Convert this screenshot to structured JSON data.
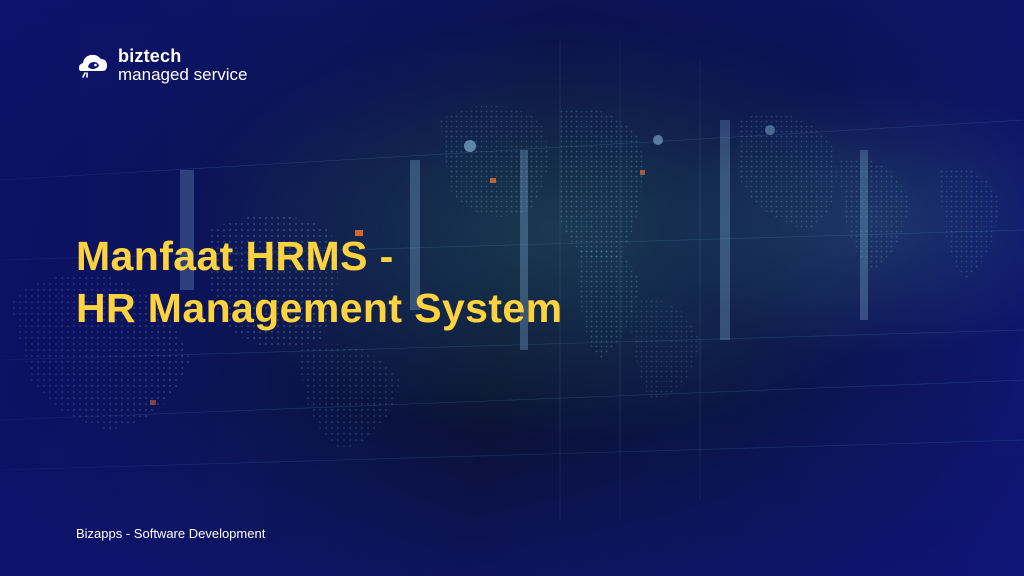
{
  "logo": {
    "name": "biztech",
    "sub": "managed service"
  },
  "headline": {
    "line1": "Manfaat HRMS -",
    "line2": "HR Management System"
  },
  "footer": {
    "text": "Bizapps - Software Development"
  },
  "colors": {
    "background_dark": "#0a1230",
    "background_blue": "#0e1673",
    "headline": "#ffd23f",
    "text": "#ffffff"
  },
  "icons": {
    "logo_mark": "cloud-bird-icon"
  }
}
